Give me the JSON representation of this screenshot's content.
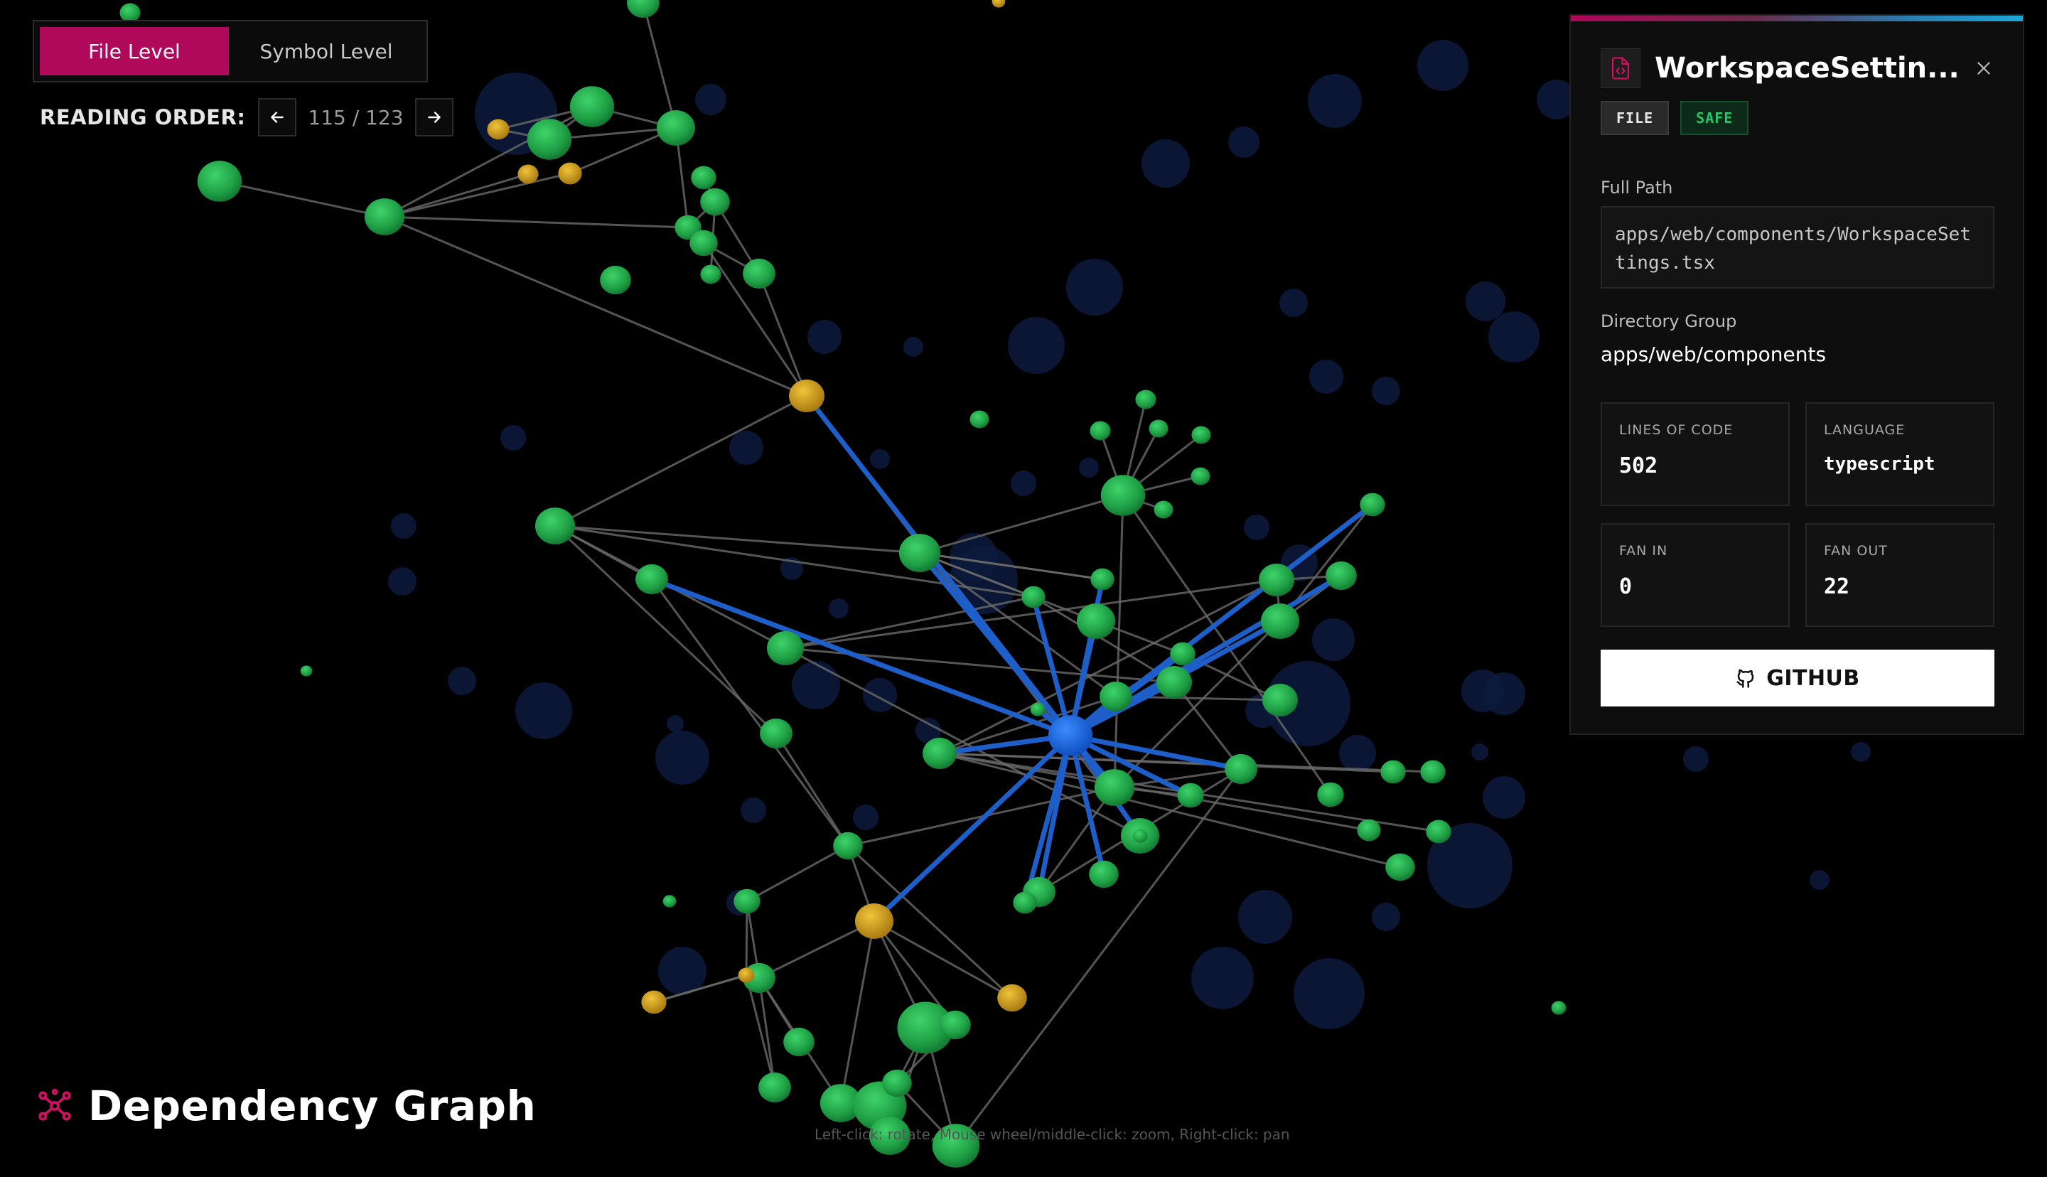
{
  "controls": {
    "levels": [
      "File Level",
      "Symbol Level"
    ],
    "active_level": "File Level",
    "reading_order_label": "READING ORDER:",
    "reading_order_count": "115 / 123"
  },
  "graph": {
    "title": "Dependency Graph",
    "hint": "Left-click: rotate, Mouse wheel/middle-click: zoom, Right-click: pan",
    "colors": {
      "file_node": "#22a84a",
      "flagged_node": "#c9a020",
      "selected_node": "#1f6fe8",
      "edge": "#6b6b6b",
      "selected_edge": "#1e5ec8"
    }
  },
  "panel": {
    "title": "WorkspaceSettin...",
    "badges": {
      "type": "FILE",
      "status": "SAFE"
    },
    "full_path_label": "Full Path",
    "full_path": "apps/web/components/WorkspaceSettings.tsx",
    "directory_group_label": "Directory Group",
    "directory_group": "apps/web/components",
    "stats": {
      "lines_of_code_label": "LINES OF CODE",
      "lines_of_code": "502",
      "language_label": "LANGUAGE",
      "language": "typescript",
      "fan_in_label": "FAN IN",
      "fan_in": "0",
      "fan_out_label": "FAN OUT",
      "fan_out": "22"
    },
    "github_label": "GITHUB"
  }
}
